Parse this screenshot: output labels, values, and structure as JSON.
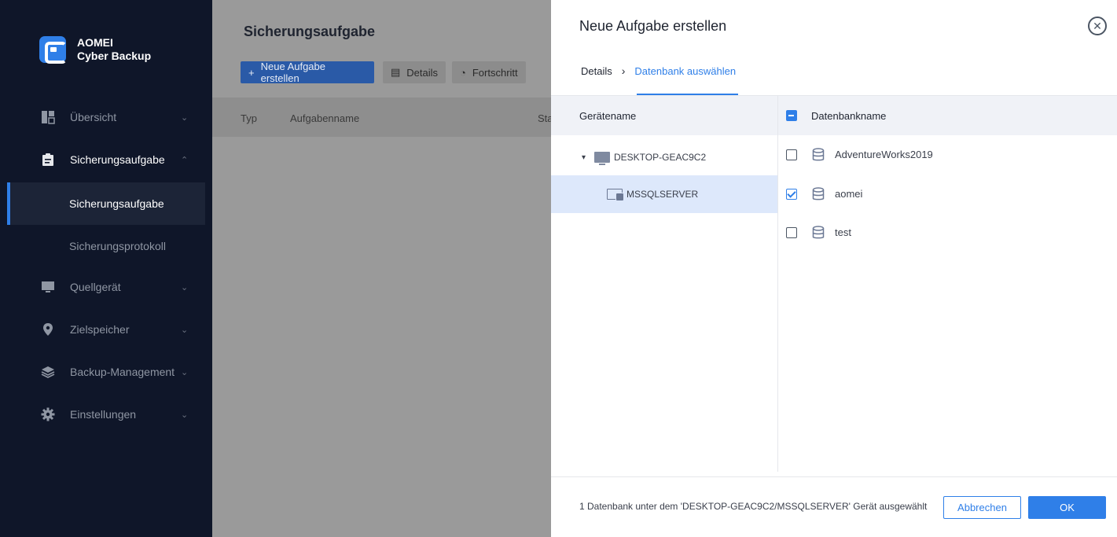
{
  "app": {
    "brand_line1": "AOMEI",
    "brand_line2": "Cyber Backup",
    "accent_color": "#2f7fe8",
    "sidebar_bg": "#0f1629"
  },
  "sidebar": {
    "items": [
      {
        "label": "Übersicht",
        "icon": "dashboard-icon"
      },
      {
        "label": "Sicherungsaufgabe",
        "icon": "clipboard-icon"
      },
      {
        "label": "Sicherungsaufgabe",
        "icon": ""
      },
      {
        "label": "Sicherungsprotokoll",
        "icon": ""
      },
      {
        "label": "Quellgerät",
        "icon": "monitor-icon"
      },
      {
        "label": "Zielspeicher",
        "icon": "location-pin-icon"
      },
      {
        "label": "Backup-Management",
        "icon": "layers-icon"
      },
      {
        "label": "Einstellungen",
        "icon": "gear-icon"
      }
    ]
  },
  "main": {
    "title": "Sicherungsaufgabe",
    "btn_new": "Neue Aufgabe erstellen",
    "btn_details": "Details",
    "btn_progress": "Fortschritt",
    "col_type": "Typ",
    "col_name": "Aufgabenname",
    "col_status": "Sta"
  },
  "dialog": {
    "title": "Neue Aufgabe erstellen",
    "step1": "Details",
    "step2": "Datenbank auswählen",
    "left_header": "Gerätename",
    "right_header": "Datenbankname",
    "device": "DESKTOP-GEAC9C2",
    "instance": "MSSQLSERVER",
    "databases": [
      {
        "name": "AdventureWorks2019",
        "checked": false
      },
      {
        "name": "aomei",
        "checked": true
      },
      {
        "name": "test",
        "checked": false
      }
    ],
    "footer_text": "1 Datenbank unter dem 'DESKTOP-GEAC9C2/MSSQLSERVER' Gerät ausgewählt",
    "cancel": "Abbrechen",
    "ok": "OK"
  }
}
